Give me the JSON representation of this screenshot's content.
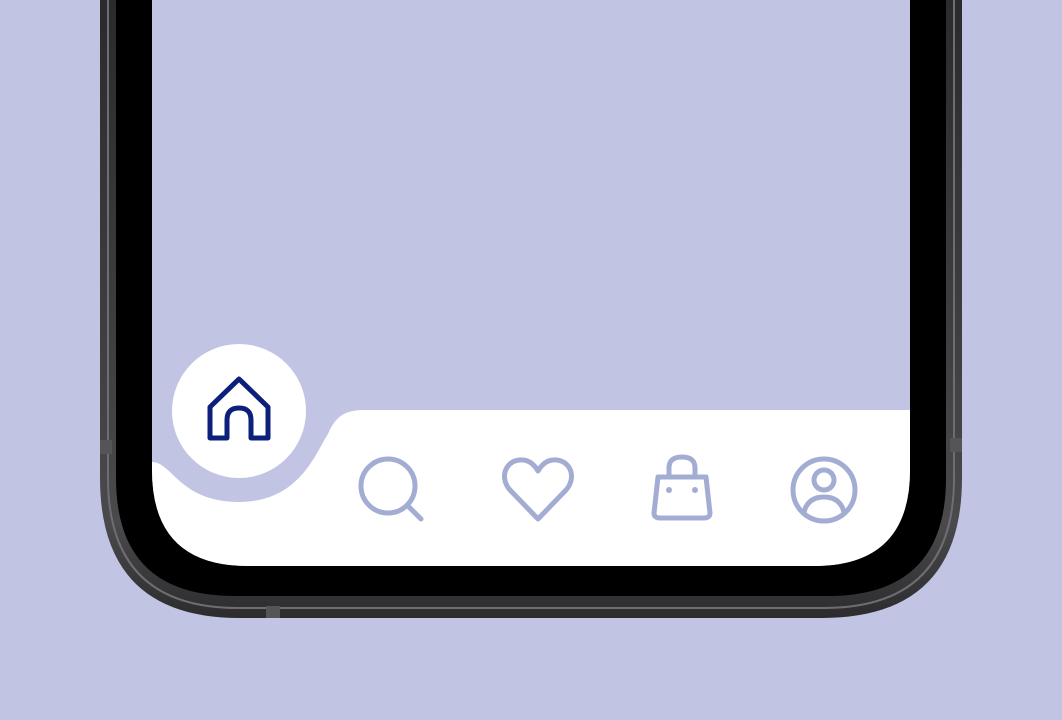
{
  "colors": {
    "background": "#c2c4e4",
    "screen": "#c2c4e4",
    "nav_bar": "#ffffff",
    "active_icon": "#0c1f7a",
    "inactive_icon": "#a3acd2",
    "bezel": "#000000",
    "frame": "#3a3a3c"
  },
  "bottom_nav": {
    "active": "home",
    "items": [
      {
        "id": "home",
        "icon": "home-icon",
        "state": "active"
      },
      {
        "id": "search",
        "icon": "search-icon",
        "state": "inactive"
      },
      {
        "id": "favorites",
        "icon": "heart-icon",
        "state": "inactive"
      },
      {
        "id": "bag",
        "icon": "shopping-bag-icon",
        "state": "inactive"
      },
      {
        "id": "profile",
        "icon": "profile-icon",
        "state": "inactive"
      }
    ]
  }
}
